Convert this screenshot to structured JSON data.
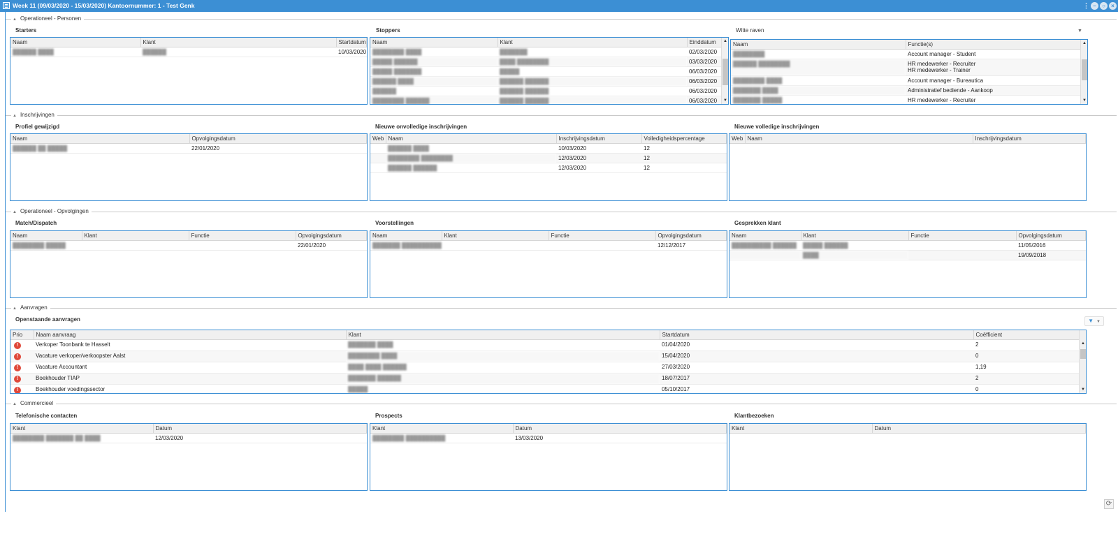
{
  "window": {
    "title": "Week 11 (09/03/2020 - 15/03/2020) Kantoornummer: 1 - Test Genk",
    "icons": [
      "app-icon",
      "menu-icon",
      "minimize-icon",
      "restore-icon",
      "close-icon"
    ]
  },
  "sections": {
    "personen": "Operationeel - Personen",
    "inschrijvingen": "Inschrijvingen",
    "opvolgingen": "Operationeel - Opvolgingen",
    "aanvragen": "Aanvragen",
    "commercieel": "Commercieel"
  },
  "starters": {
    "title": "Starters",
    "columns": [
      "Naam",
      "Klant",
      "Startdatum"
    ],
    "rows": [
      [
        "██████ ████",
        "██████",
        "10/03/2020"
      ]
    ]
  },
  "stoppers": {
    "title": "Stoppers",
    "columns": [
      "Naam",
      "Klant",
      "Einddatum"
    ],
    "rows": [
      [
        "████████ ████",
        "███████",
        "02/03/2020"
      ],
      [
        "█████ ██████",
        "████ ████████",
        "03/03/2020"
      ],
      [
        "█████ ███████",
        "█████",
        "06/03/2020"
      ],
      [
        "██████ ████",
        "██████ ██████",
        "06/03/2020"
      ],
      [
        "██████",
        "██████ ██████",
        "06/03/2020"
      ],
      [
        "████████ ██████",
        "██████ ██████",
        "06/03/2020"
      ]
    ]
  },
  "witte_raven": {
    "title": "Witte raven",
    "columns": [
      "Naam",
      "Functie(s)"
    ],
    "rows": [
      [
        "████████",
        "Account manager - Student",
        ""
      ],
      [
        "██████ ████████",
        "HR medewerker - Recruiter",
        "HR medewerker - Trainer"
      ],
      [
        "████████ ████",
        "Account manager - Bureautica",
        ""
      ],
      [
        "███████ ████",
        "Administratief bediende - Aankoop",
        ""
      ],
      [
        "███████ █████",
        "HR medewerker - Recruiter",
        ""
      ]
    ]
  },
  "profiel_gewijzigd": {
    "title": "Profiel gewijzigd",
    "columns": [
      "Naam",
      "Opvolgingsdatum"
    ],
    "rows": [
      [
        "██████ ██ █████",
        "22/01/2020"
      ]
    ]
  },
  "onvolledige": {
    "title": "Nieuwe onvolledige inschrijvingen",
    "columns": [
      "Web",
      "Naam",
      "Inschrijvingsdatum",
      "Volledigheidspercentage"
    ],
    "rows": [
      [
        "",
        "██████ ████",
        "10/03/2020",
        "12"
      ],
      [
        "",
        "████████ ████████",
        "12/03/2020",
        "12"
      ],
      [
        "",
        "██████ ██████",
        "12/03/2020",
        "12"
      ]
    ]
  },
  "volledige": {
    "title": "Nieuwe volledige inschrijvingen",
    "columns": [
      "Web",
      "Naam",
      "Inschrijvingsdatum"
    ],
    "rows": []
  },
  "match_dispatch": {
    "title": "Match/Dispatch",
    "columns": [
      "Naam",
      "Klant",
      "Functie",
      "Opvolgingsdatum"
    ],
    "rows": [
      [
        "████████ █████",
        "",
        "",
        "22/01/2020"
      ]
    ]
  },
  "voorstellingen": {
    "title": "Voorstellingen",
    "columns": [
      "Naam",
      "Klant",
      "Functie",
      "Opvolgingsdatum"
    ],
    "rows": [
      [
        "███████ ████████████",
        "",
        "",
        "12/12/2017"
      ]
    ]
  },
  "gesprekken_klant": {
    "title": "Gesprekken klant",
    "columns": [
      "Naam",
      "Klant",
      "Functie",
      "Opvolgingsdatum"
    ],
    "rows": [
      [
        "██████████ ██████",
        "█████ ██████",
        "",
        "11/05/2016"
      ],
      [
        "",
        "████",
        "",
        "19/09/2018"
      ]
    ]
  },
  "openstaande_aanvragen": {
    "title": "Openstaande aanvragen",
    "columns": [
      "Prio",
      "Naam aanvraag",
      "Klant",
      "Startdatum",
      "Coëfficient"
    ],
    "rows": [
      [
        "!",
        "Verkoper Toonbank te Hasselt",
        "███████ ████",
        "01/04/2020",
        "2"
      ],
      [
        "!",
        "Vacature verkoper/verkoopster Aalst",
        "████████ ████",
        "15/04/2020",
        "0"
      ],
      [
        "!",
        "Vacature Accountant",
        "████ ████ ██████",
        "27/03/2020",
        "1,19"
      ],
      [
        "!",
        "Boekhouder TIAP",
        "███████ ██████",
        "18/07/2017",
        "2"
      ],
      [
        "!",
        "Boekhouder voedingssector",
        "█████",
        "05/10/2017",
        "0"
      ]
    ],
    "filter_icon": "filter-icon"
  },
  "telefonische_contacten": {
    "title": "Telefonische contacten",
    "columns": [
      "Klant",
      "Datum"
    ],
    "rows": [
      [
        "████████ ███████ ██ ████",
        "12/03/2020"
      ]
    ]
  },
  "prospects": {
    "title": "Prospects",
    "columns": [
      "Klant",
      "Datum"
    ],
    "rows": [
      [
        "████████ ██████████",
        "13/03/2020"
      ]
    ]
  },
  "klantbezoeken": {
    "title": "Klantbezoeken",
    "columns": [
      "Klant",
      "Datum"
    ],
    "rows": []
  },
  "colors": {
    "titlebar": "#3c8fd4",
    "grid_border": "#3c8fd4",
    "prio": "#e0483a"
  }
}
